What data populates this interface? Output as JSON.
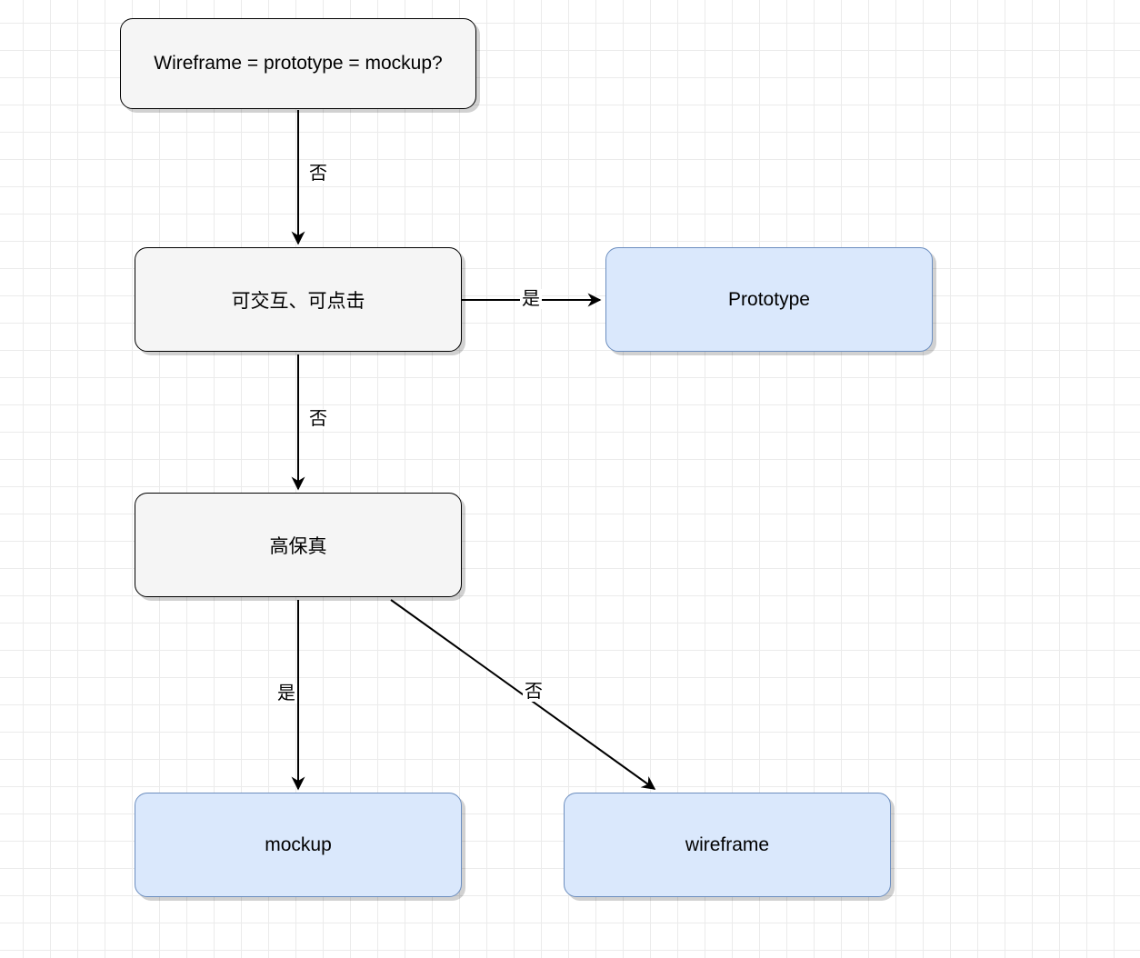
{
  "nodes": {
    "start": {
      "label": "Wireframe = prototype = mockup?"
    },
    "interactive": {
      "label": "可交互、可点击"
    },
    "hifidelity": {
      "label": "高保真"
    },
    "prototype": {
      "label": "Prototype"
    },
    "mockup": {
      "label": "mockup"
    },
    "wireframe": {
      "label": "wireframe"
    }
  },
  "edges": {
    "start_to_interactive": {
      "label": "否"
    },
    "interactive_to_prototype": {
      "label": "是"
    },
    "interactive_to_hifi": {
      "label": "否"
    },
    "hifi_to_mockup": {
      "label": "是"
    },
    "hifi_to_wireframe": {
      "label": "否"
    }
  }
}
